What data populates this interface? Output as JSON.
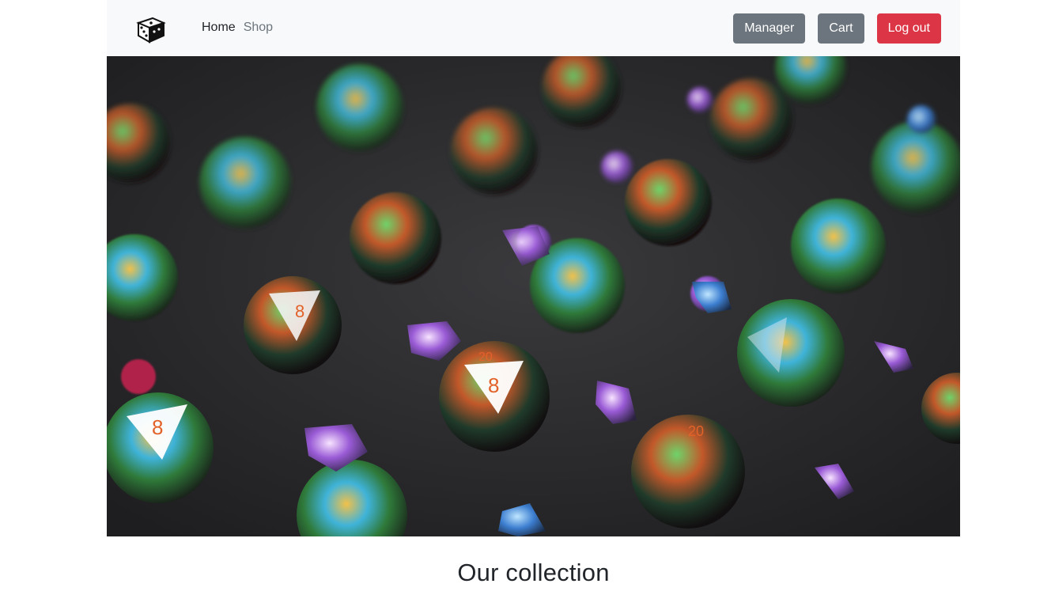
{
  "nav": {
    "logo_icon": "dice-icon",
    "links": [
      {
        "label": "Home",
        "active": true
      },
      {
        "label": "Shop",
        "active": false
      }
    ],
    "buttons": {
      "manager": "Manager",
      "cart": "Cart",
      "logout": "Log out"
    }
  },
  "hero": {
    "image_subject": "polyhedral-dice-photo"
  },
  "collection": {
    "title": "Our collection"
  },
  "colors": {
    "navbar_bg": "#f8f9fa",
    "secondary": "#6c757d",
    "danger": "#dc3545",
    "text": "#212529"
  }
}
